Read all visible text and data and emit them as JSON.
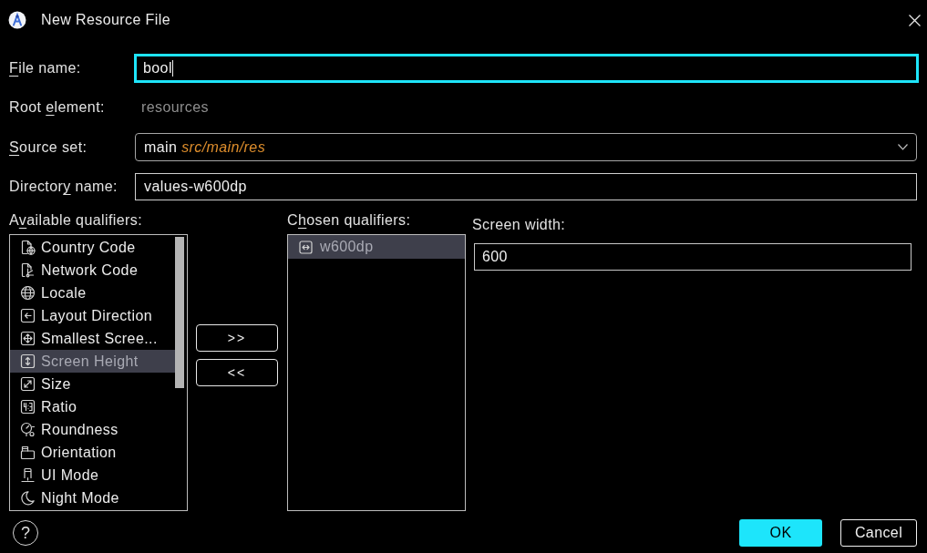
{
  "window": {
    "title": "New Resource File"
  },
  "file_name": {
    "label": {
      "mnemonic": "F",
      "after": "ile name:"
    },
    "value": "bool",
    "focused": true
  },
  "root_element": {
    "label": {
      "before": "Root ",
      "mnemonic": "e",
      "after": "lement:"
    },
    "value": "resources"
  },
  "source_set": {
    "label": {
      "mnemonic": "S",
      "after": "ource set:"
    },
    "value": "main *src/main/res*"
  },
  "directory_name": {
    "label": {
      "before": "Director",
      "mnemonic": "y",
      "after": " name:"
    },
    "value": "values-w600dp"
  },
  "available_qualifiers": {
    "label": {
      "before": "A",
      "mnemonic": "v",
      "after": "ailable qualifiers:"
    },
    "items": [
      {
        "label": "Country Code",
        "selected": false
      },
      {
        "label": "Network Code",
        "selected": false
      },
      {
        "label": "Locale",
        "selected": false
      },
      {
        "label": "Layout Direction",
        "selected": false
      },
      {
        "label": "Smallest Scree...",
        "selected": false
      },
      {
        "label": "Screen Height",
        "selected": true
      },
      {
        "label": "Size",
        "selected": false
      },
      {
        "label": "Ratio",
        "selected": false
      },
      {
        "label": "Roundness",
        "selected": false
      },
      {
        "label": "Orientation",
        "selected": false
      },
      {
        "label": "UI Mode",
        "selected": false
      },
      {
        "label": "Night Mode",
        "selected": false
      }
    ]
  },
  "move_buttons": [
    {
      "label": ">>"
    },
    {
      "label": "<<"
    }
  ],
  "chosen_qualifiers": {
    "label": {
      "before": "C",
      "mnemonic": "h",
      "after": "osen qualifiers:"
    },
    "items": [
      {
        "label": "w600dp",
        "selected": true
      }
    ]
  },
  "screen_width": {
    "label": "Screen width:",
    "value": "600"
  },
  "footer": {
    "help_button": {
      "label": "?"
    },
    "buttons": [
      {
        "label": "OK",
        "kind": "primary"
      },
      {
        "label": "Cancel",
        "kind": "secondary"
      }
    ]
  }
}
